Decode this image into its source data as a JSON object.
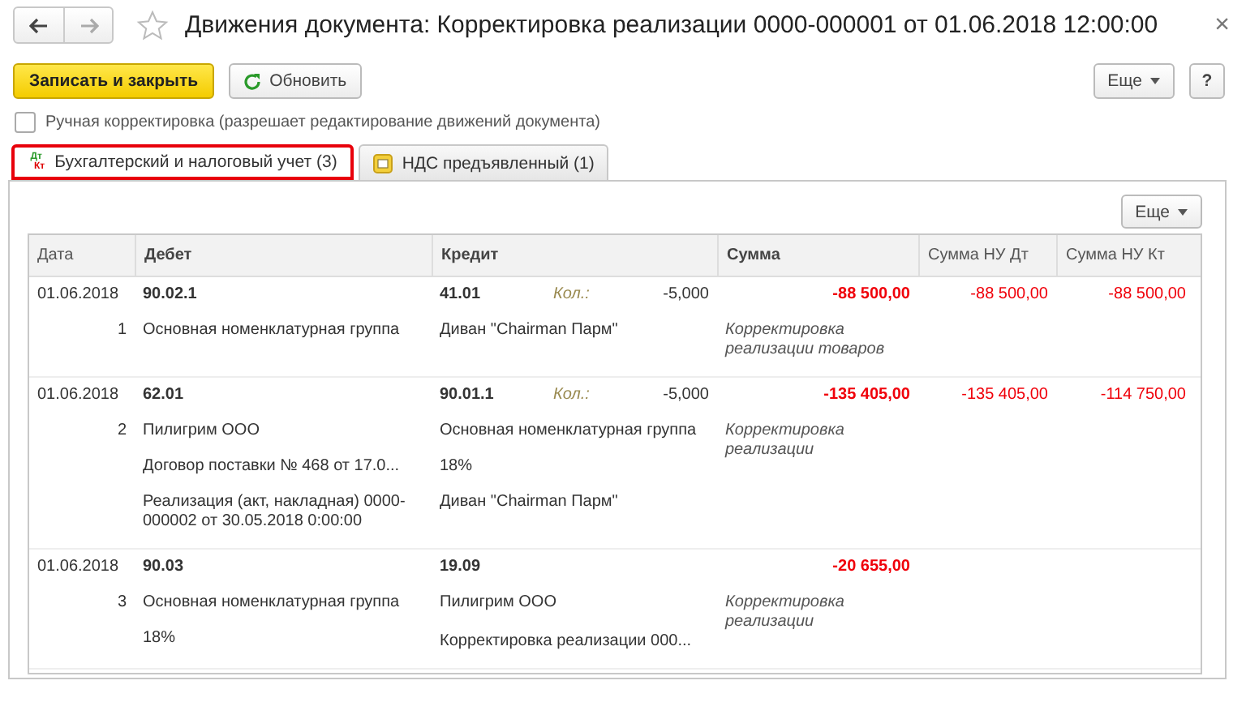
{
  "window": {
    "title": "Движения документа: Корректировка реализации 0000-000001 от 01.06.2018 12:00:00",
    "close": "×"
  },
  "toolbar": {
    "primary": "Записать и закрыть",
    "refresh": "Обновить",
    "more": "Еще",
    "help": "?"
  },
  "manual_correction": {
    "label": "Ручная корректировка (разрешает редактирование движений документа)",
    "checked": false
  },
  "tabs": [
    {
      "label": "Бухгалтерский и налоговый учет (3)",
      "kind": "dtkt",
      "icon_top": "Дт",
      "icon_bottom": "Кт",
      "selected": true,
      "highlighted": true
    },
    {
      "label": "НДС предъявленный (1)",
      "kind": "register",
      "selected": false,
      "highlighted": false
    }
  ],
  "table": {
    "more": "Еще",
    "columns": [
      "Дата",
      "Дебет",
      "Кредит",
      "Сумма",
      "Сумма НУ Дт",
      "Сумма НУ Кт"
    ],
    "rows": [
      {
        "date": "01.06.2018",
        "number": "1",
        "debit": {
          "account": "90.02.1",
          "lines": [
            {
              "text": "Основная номенклатурная группа"
            }
          ]
        },
        "credit": {
          "account": "41.01",
          "qty_label": "Кол.:",
          "qty": "-5,000",
          "lines": [
            {
              "text": "Диван \"Chairman Парм\""
            }
          ]
        },
        "sum": "-88 500,00",
        "content": "Корректировка реализации товаров",
        "sum_nu_dt": "-88 500,00",
        "sum_nu_kt": "-88 500,00"
      },
      {
        "date": "01.06.2018",
        "number": "2",
        "debit": {
          "account": "62.01",
          "lines": [
            {
              "text": "Пилигрим ООО"
            },
            {
              "text": "Договор поставки № 468 от 17.0..."
            },
            {
              "text": "Реализация (акт, накладная) 0000-000002 от 30.05.2018 0:00:00"
            }
          ]
        },
        "credit": {
          "account": "90.01.1",
          "qty_label": "Кол.:",
          "qty": "-5,000",
          "lines": [
            {
              "text": "Основная номенклатурная группа"
            },
            {
              "text": "18%"
            },
            {
              "text": "Диван \"Chairman Парм\""
            }
          ]
        },
        "sum": "-135 405,00",
        "content": "Корректировка реализации",
        "sum_nu_dt": "-135 405,00",
        "sum_nu_kt": "-114 750,00"
      },
      {
        "date": "01.06.2018",
        "number": "3",
        "debit": {
          "account": "90.03",
          "lines": [
            {
              "text": "Основная номенклатурная группа"
            },
            {
              "text": "18%"
            }
          ]
        },
        "credit": {
          "account": "19.09",
          "lines": [
            {
              "text": "Пилигрим ООО"
            },
            {
              "text": "Корректировка реализации 000...",
              "after_blank": true
            }
          ]
        },
        "sum": "-20 655,00",
        "content": "Корректировка реализации"
      }
    ]
  }
}
